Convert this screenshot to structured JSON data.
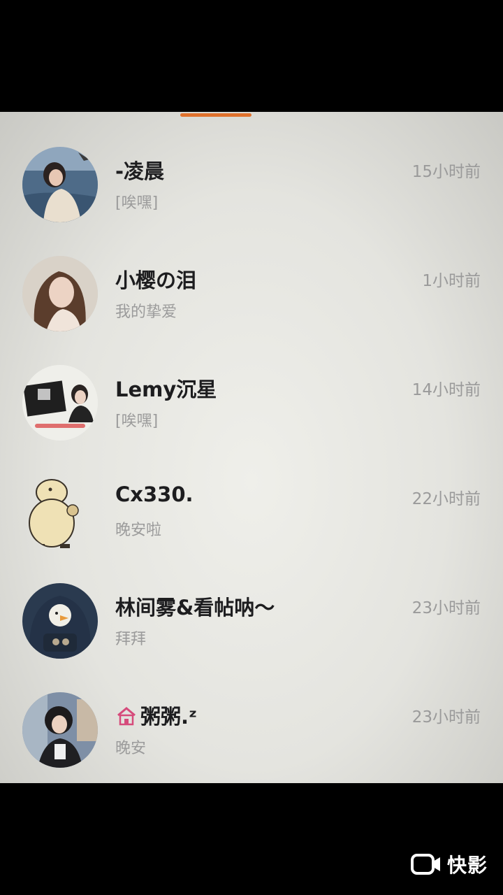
{
  "conversations": [
    {
      "name": "-凌晨",
      "preview": "[唉嘿]",
      "time": "15小时前",
      "avatar_icon": "photo-girl-sea-avatar-icon"
    },
    {
      "name": "小樱の泪",
      "preview": "我的挚爱",
      "time": "1小时前",
      "avatar_icon": "photo-girl-avatar-icon"
    },
    {
      "name": "Lemy沉星",
      "preview": "[唉嘿]",
      "time": "14小时前",
      "avatar_icon": "sign-girl-avatar-icon"
    },
    {
      "name": "Cx330.",
      "preview": "晚安啦",
      "time": "22小时前",
      "avatar_icon": "capybara-avatar-icon"
    },
    {
      "name": "林间雾&看帖呐～",
      "preview": "拜拜",
      "time": "23小时前",
      "avatar_icon": "duck-hood-avatar-icon"
    },
    {
      "name": "粥粥.ᶻ",
      "preview": "晚安",
      "time": "23小时前",
      "avatar_icon": "photo-girl-room-avatar-icon",
      "name_emoji": "house-emoji-icon"
    }
  ],
  "watermark": {
    "label": "快影",
    "icon": "video-camera-icon"
  },
  "colors": {
    "accent": "#e0712c",
    "name": "#1d1d1f",
    "muted": "#9b9b9b"
  }
}
